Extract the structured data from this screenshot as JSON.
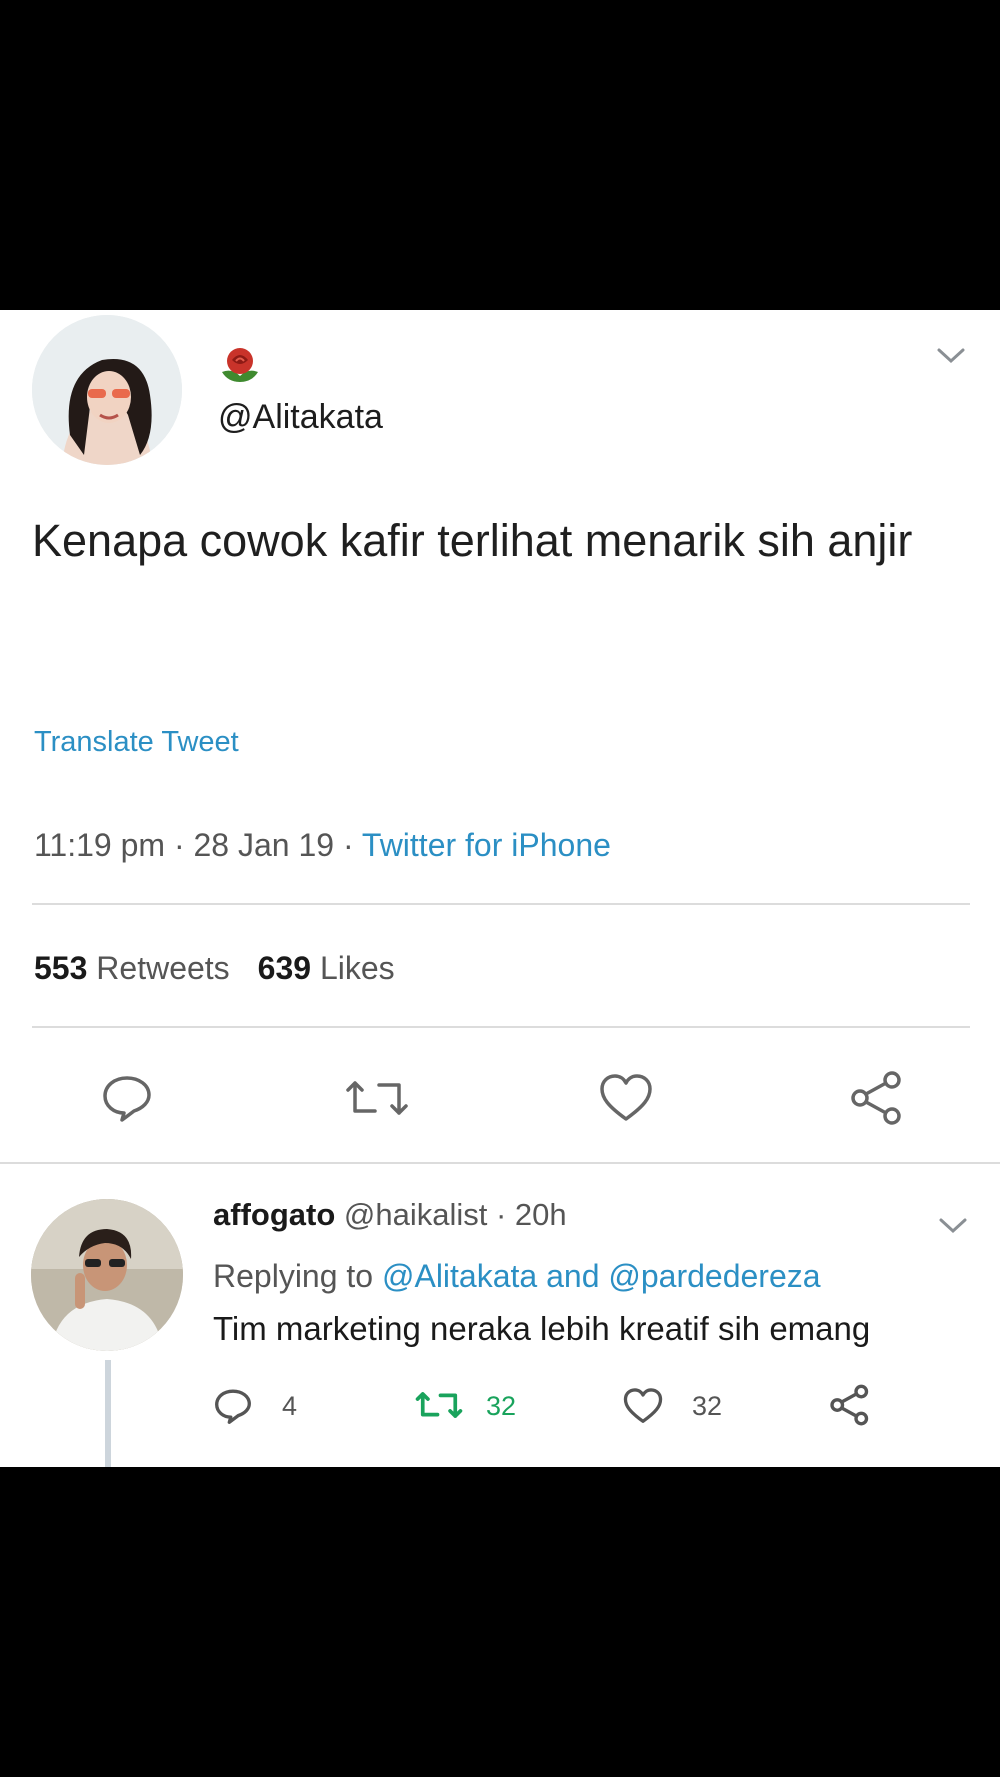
{
  "tweet": {
    "handle": "@Alitakata",
    "name_emoji": "rose-emoji",
    "text": "Kenapa cowok kafir terlihat menarik sih anjir",
    "translate_label": "Translate Tweet",
    "time": "11:19 pm",
    "date": "28 Jan 19",
    "source": "Twitter for iPhone",
    "separator": " · ",
    "retweets_count": "553",
    "retweets_label": "Retweets",
    "likes_count": "639",
    "likes_label": "Likes",
    "actions": [
      "reply-icon",
      "retweet-icon",
      "like-icon",
      "share-icon"
    ]
  },
  "reply": {
    "name": "affogato",
    "handle": "@haikalist",
    "age": "20h",
    "separator": " · ",
    "replying_prefix": "Replying to",
    "replying_to_1": "@Alitakata",
    "replying_and": "and",
    "replying_to_2": "@pardedereza",
    "text": "Tim marketing neraka lebih kreatif sih emang",
    "reply_count": "4",
    "retweet_count": "32",
    "like_count": "32"
  },
  "colors": {
    "link": "#2b8fc4",
    "retweet_active": "#19a35c",
    "text_primary": "#1a1a1a",
    "text_secondary": "#555555",
    "background_bars": "#000000"
  }
}
